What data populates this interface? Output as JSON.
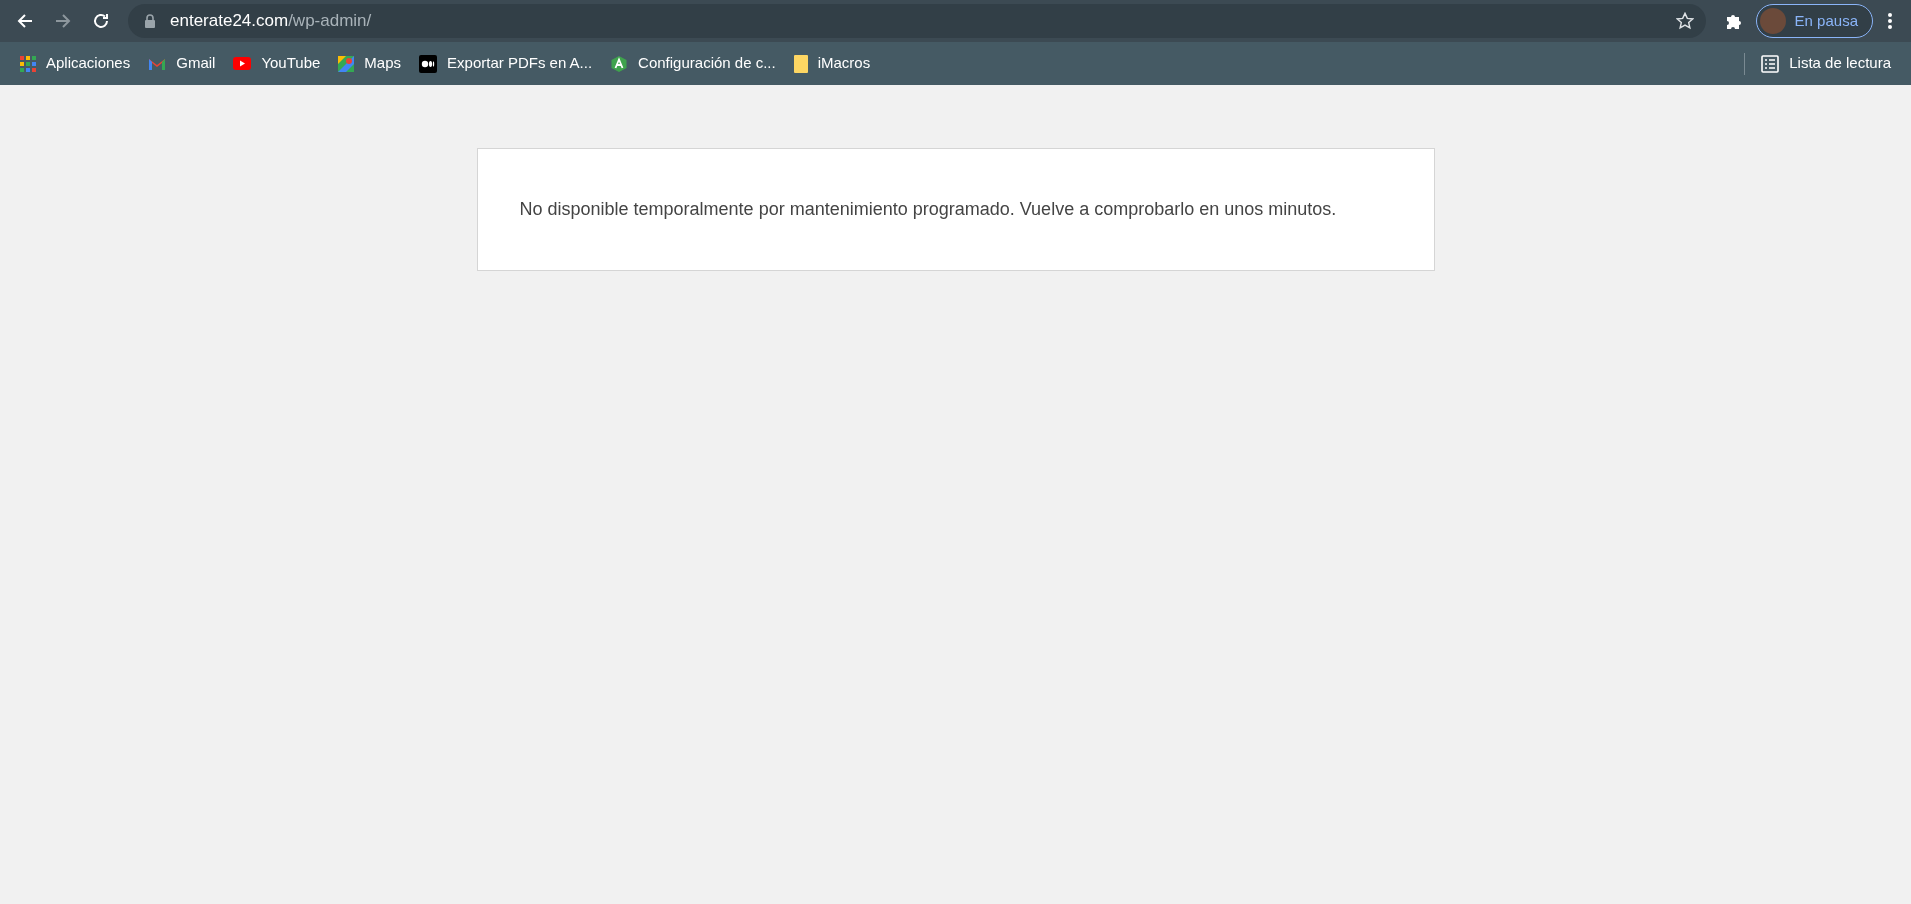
{
  "toolbar": {
    "back_disabled": false,
    "forward_disabled": true,
    "url_host": "enterate24.com",
    "url_path": "/wp-admin/",
    "profile_label": "En pausa"
  },
  "bookmarks": [
    {
      "kind": "apps",
      "label": "Aplicaciones"
    },
    {
      "kind": "gmail",
      "label": "Gmail"
    },
    {
      "kind": "youtube",
      "label": "YouTube"
    },
    {
      "kind": "maps",
      "label": "Maps"
    },
    {
      "kind": "medium",
      "label": "Exportar PDFs en A..."
    },
    {
      "kind": "green",
      "label": "Configuración de c..."
    },
    {
      "kind": "note",
      "label": "iMacros"
    }
  ],
  "reading_list": "Lista de lectura",
  "page": {
    "message": "No disponible temporalmente por mantenimiento programado. Vuelve a comprobarlo en unos minutos."
  }
}
